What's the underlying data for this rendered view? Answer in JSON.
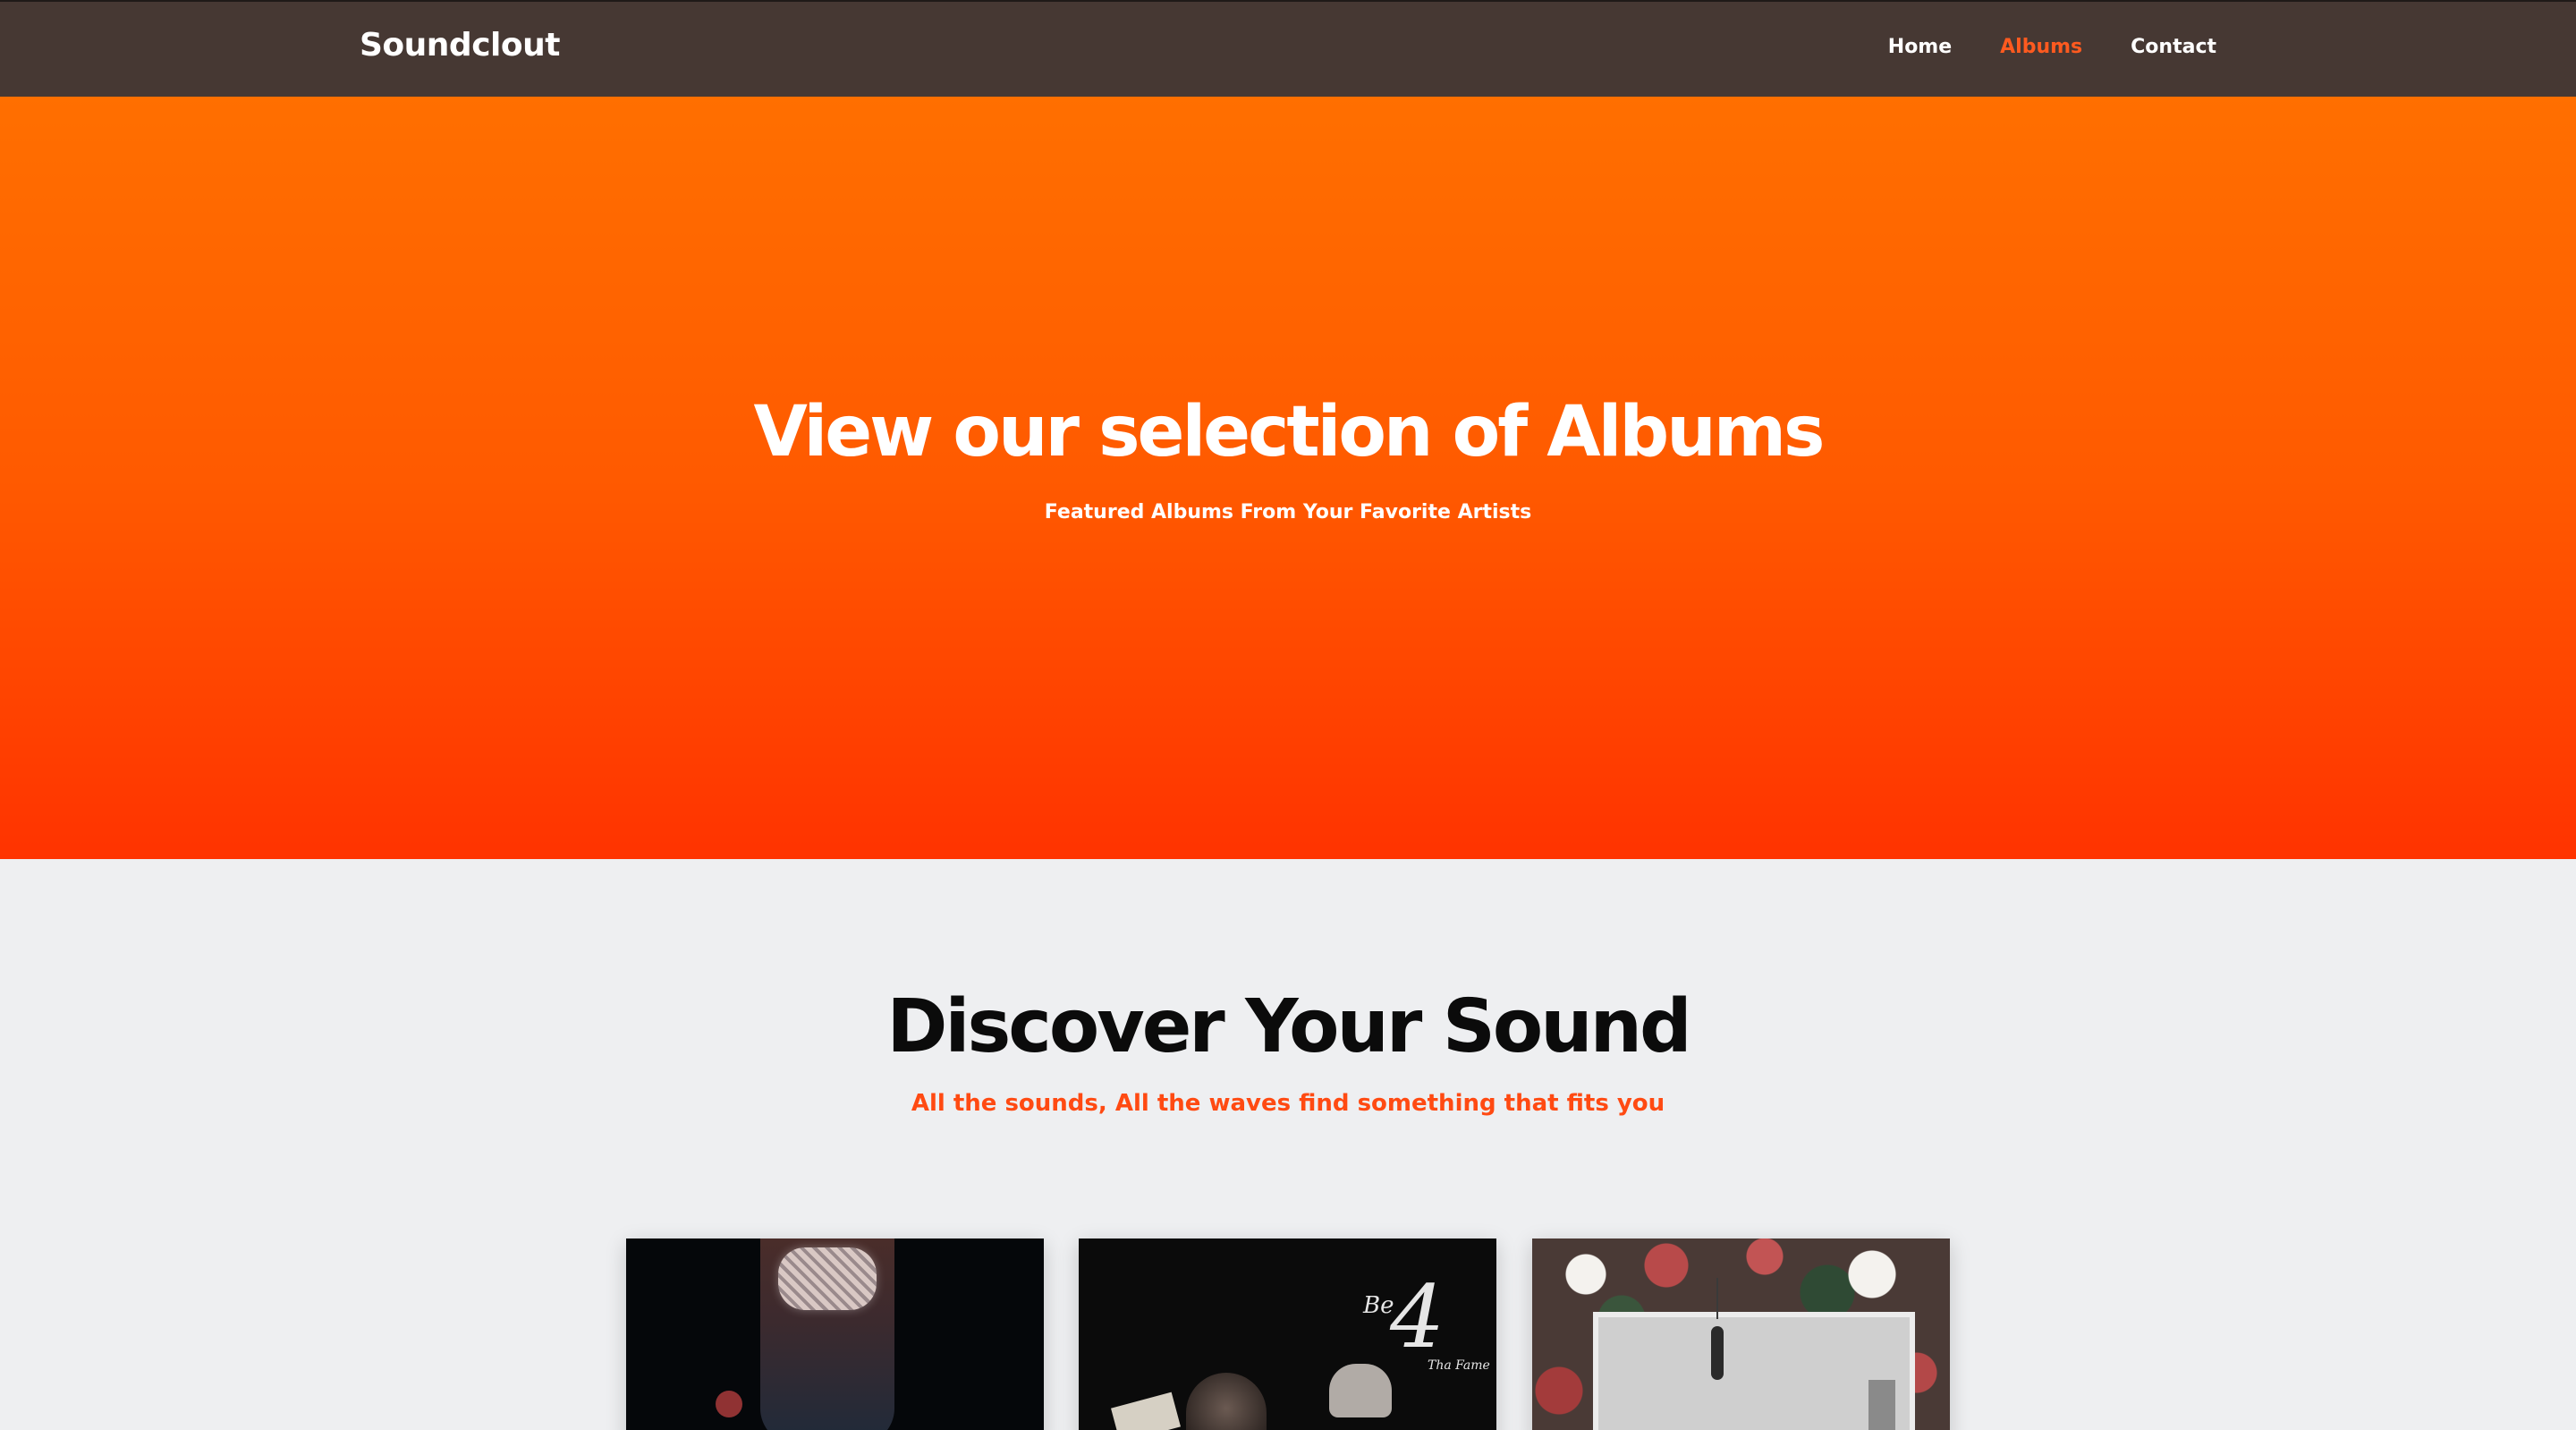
{
  "navbar": {
    "brand": "Soundclout",
    "links": [
      {
        "label": "Home",
        "active": false
      },
      {
        "label": "Albums",
        "active": true
      },
      {
        "label": "Contact",
        "active": false
      }
    ]
  },
  "hero": {
    "title": "View our selection of Albums",
    "subtitle": "Featured Albums From Your Favorite Artists"
  },
  "discover": {
    "title": "Discover Your Sound",
    "subtitle": "All the sounds, All the waves find something that fits you"
  },
  "albums": [
    {
      "cover_text": ""
    },
    {
      "cover_text_be": "Be",
      "cover_text_four": "4",
      "cover_text_fame": "Tha Fame"
    },
    {
      "cover_text": ""
    }
  ],
  "colors": {
    "nav_bg": "#463833",
    "accent": "#ff5a1f",
    "hero_top": "#ff6f00",
    "hero_bottom": "#ff3300",
    "section_bg": "#eeeff1"
  }
}
